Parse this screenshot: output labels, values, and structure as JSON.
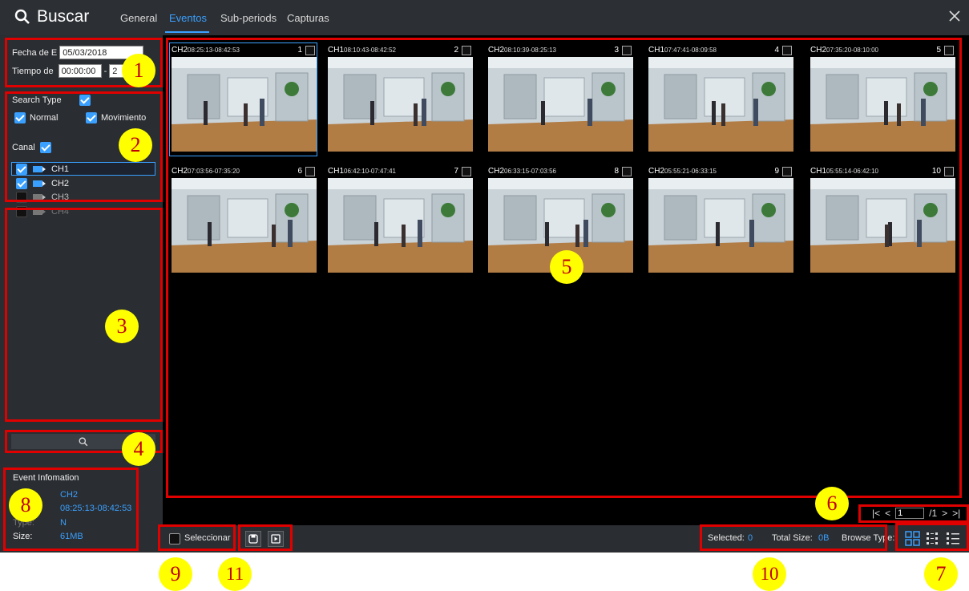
{
  "header": {
    "title": "Buscar",
    "tabs": [
      {
        "label": "General",
        "active": false
      },
      {
        "label": "Eventos",
        "active": true
      },
      {
        "label": "Sub-periods",
        "active": false
      },
      {
        "label": "Capturas",
        "active": false
      }
    ]
  },
  "filters": {
    "date_label": "Fecha de E",
    "date_value": "05/03/2018",
    "time_label": "Tiempo de",
    "time_start": "00:00:00",
    "time_sep": "-",
    "time_end": "2",
    "search_type_label": "Search Type",
    "normal_label": "Normal",
    "movement_label": "Movimiento",
    "channel_label": "Canal",
    "channels": [
      {
        "label": "CH1",
        "checked": true
      },
      {
        "label": "CH2",
        "checked": true
      },
      {
        "label": "CH3",
        "checked": false
      },
      {
        "label": "CH4",
        "checked": false
      }
    ]
  },
  "event_info": {
    "heading": "Event Infomation",
    "channel": "CH2",
    "time": "08:25:13-08:42:53",
    "type_label": "Type:",
    "type_value": "N",
    "size_label": "Size:",
    "size_value": "61MB"
  },
  "events": [
    {
      "ch": "CH2",
      "time": "08:25:13-08:42:53",
      "num": "1"
    },
    {
      "ch": "CH1",
      "time": "08:10:43-08:42:52",
      "num": "2"
    },
    {
      "ch": "CH2",
      "time": "08:10:39-08:25:13",
      "num": "3"
    },
    {
      "ch": "CH1",
      "time": "07:47:41-08:09:58",
      "num": "4"
    },
    {
      "ch": "CH2",
      "time": "07:35:20-08:10:00",
      "num": "5"
    },
    {
      "ch": "CH2",
      "time": "07:03:56-07:35:20",
      "num": "6"
    },
    {
      "ch": "CH1",
      "time": "06:42:10-07:47:41",
      "num": "7"
    },
    {
      "ch": "CH2",
      "time": "06:33:15-07:03:56",
      "num": "8"
    },
    {
      "ch": "CH2",
      "time": "05:55:21-06:33:15",
      "num": "9"
    },
    {
      "ch": "CH1",
      "time": "05:55:14-06:42:10",
      "num": "10"
    }
  ],
  "pager": {
    "current": "1",
    "total": "/1"
  },
  "bottom": {
    "select_label": "Seleccionar",
    "selected_label": "Selected:",
    "selected_value": "0",
    "total_size_label": "Total Size:",
    "total_size_value": "0B",
    "browse_type_label": "Browse Type:"
  },
  "annotations": [
    "1",
    "2",
    "3",
    "4",
    "5",
    "6",
    "7",
    "8",
    "9",
    "10",
    "11"
  ],
  "colors": {
    "accent": "#3aa0ff",
    "annotation_red": "#e00000",
    "badge_yellow": "#ffff00"
  }
}
